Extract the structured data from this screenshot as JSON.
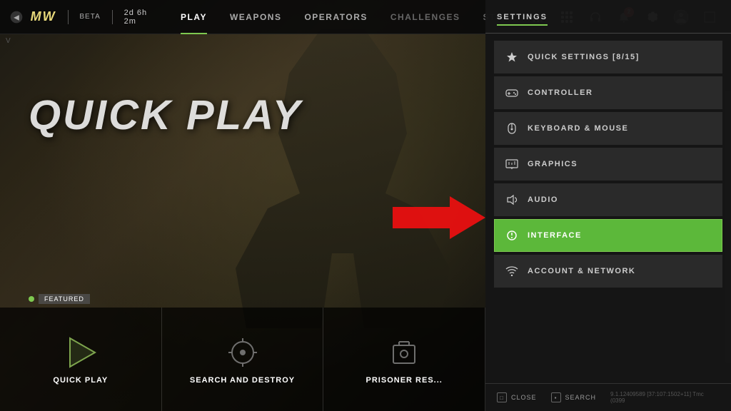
{
  "nav": {
    "back_icon": "◀",
    "logo": "MW",
    "beta_label": "BETA",
    "timer": "2d 6h 2m",
    "menu_items": [
      {
        "id": "play",
        "label": "PLAY",
        "active": true
      },
      {
        "id": "weapons",
        "label": "WEAPONS",
        "active": false
      },
      {
        "id": "operators",
        "label": "OPERATORS",
        "active": false
      },
      {
        "id": "challenges",
        "label": "CHALLENGES",
        "active": false,
        "dimmed": true
      },
      {
        "id": "store",
        "label": "STO...",
        "active": false
      }
    ],
    "notification_badge": "2"
  },
  "main": {
    "title": "QUICK PLAY",
    "featured_label": "FEATURED",
    "cards": [
      {
        "id": "quick-play",
        "title": "QUICK PLAY",
        "subtitle": ""
      },
      {
        "id": "search-and-destroy",
        "title": "SEARCH AND DESTROY",
        "subtitle": ""
      },
      {
        "id": "prisoner-rescue",
        "title": "PRISONER RES...",
        "subtitle": ""
      }
    ]
  },
  "settings": {
    "panel_title": "SETTINGS",
    "items": [
      {
        "id": "quick-settings",
        "label": "QUICK SETTINGS [8/15]",
        "icon": "star",
        "active": false
      },
      {
        "id": "controller",
        "label": "CONTROLLER",
        "icon": "gamepad",
        "active": false
      },
      {
        "id": "keyboard-mouse",
        "label": "KEYBOARD & MOUSE",
        "icon": "mouse",
        "active": false
      },
      {
        "id": "graphics",
        "label": "GRAPHICS",
        "icon": "monitor",
        "active": false
      },
      {
        "id": "audio",
        "label": "AUDIO",
        "icon": "speaker",
        "active": false
      },
      {
        "id": "interface",
        "label": "INTERFACE",
        "icon": "circle-x",
        "active": true
      },
      {
        "id": "account-network",
        "label": "ACCOUNT & NETWORK",
        "icon": "wifi",
        "active": false
      }
    ],
    "footer": {
      "close_key": "□",
      "close_label": "CLOSE",
      "search_key": "▪",
      "search_label": "SEARCH"
    },
    "version": "9.1.12409589 [37:107:1502+11] Tmc (0399"
  }
}
